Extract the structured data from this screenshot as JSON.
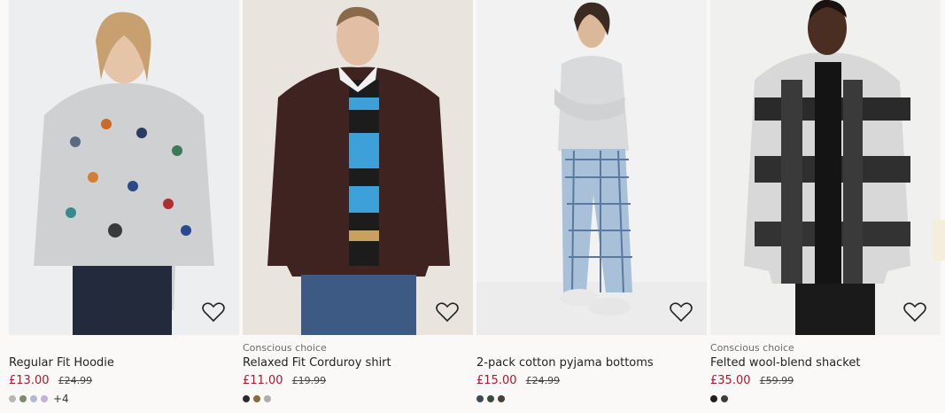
{
  "products": [
    {
      "tag": "",
      "title": "Regular Fit Hoodie",
      "price": "£13.00",
      "old_price": "£24.99",
      "swatches": [
        "#b8b8b8",
        "#7e8a6c",
        "#b3b8cf",
        "#c2b1dc"
      ],
      "more": "+4",
      "image_icon": "hoodie-photo"
    },
    {
      "tag": "Conscious choice",
      "title": "Relaxed Fit Corduroy shirt",
      "price": "£11.00",
      "old_price": "£19.99",
      "swatches": [
        "#2b2b2b",
        "#8a6a3a",
        "#b0aea8"
      ],
      "more": "",
      "image_icon": "corduroy-shirt-photo"
    },
    {
      "tag": "",
      "title": "2-pack cotton pyjama bottoms",
      "price": "£15.00",
      "old_price": "£24.99",
      "swatches": [
        "#3d4a55",
        "#3b4a41",
        "#4a3e38"
      ],
      "more": "",
      "image_icon": "pyjama-photo"
    },
    {
      "tag": "Conscious choice",
      "title": "Felted wool-blend shacket",
      "price": "£35.00",
      "old_price": "£59.99",
      "swatches": [
        "#1e1e1e",
        "#3d3d3d"
      ],
      "more": "",
      "image_icon": "shacket-photo"
    }
  ],
  "favourite_icon": "heart-icon",
  "colors": {
    "sale": "#b2142c"
  }
}
